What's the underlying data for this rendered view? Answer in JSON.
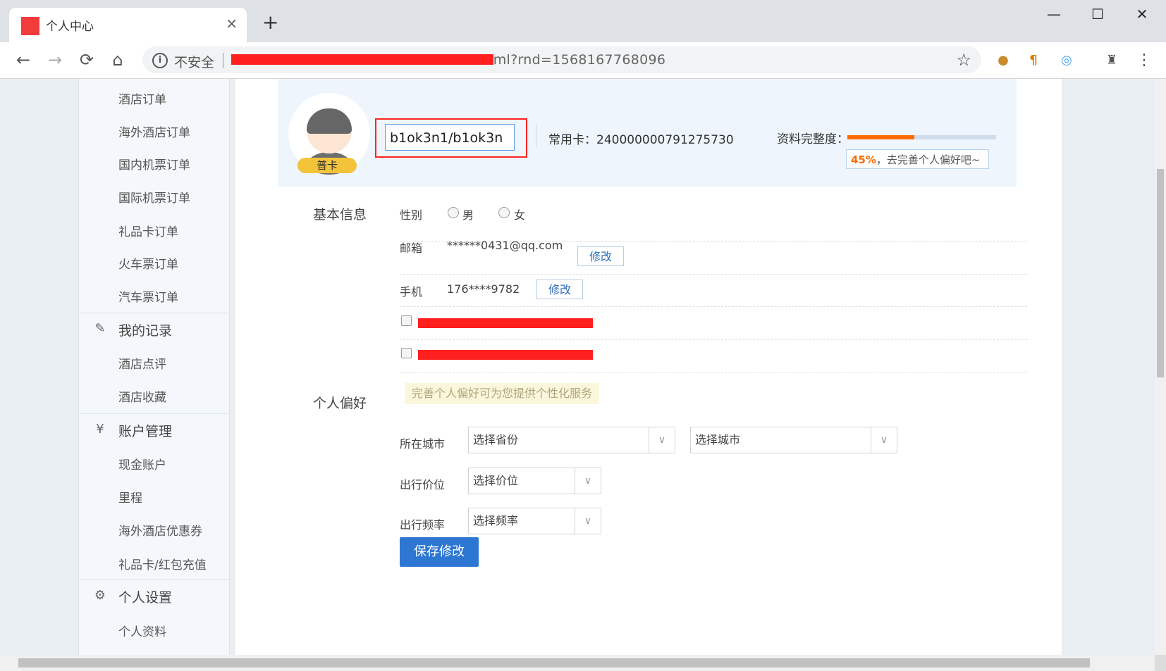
{
  "browser": {
    "tab_title": "个人中心",
    "tab_close": "×",
    "new_tab": "+",
    "window_min": "—",
    "window_max": "☐",
    "window_close": "✕",
    "back": "←",
    "forward": "→",
    "reload": "⟳",
    "home": "⌂",
    "insecure_label": "不安全",
    "url_visible": "tml?rnd=1568167768096",
    "bookmark": "☆",
    "menu": "⋮"
  },
  "sidebar": {
    "items_top": [
      "酒店订单",
      "海外酒店订单",
      "国内机票订单",
      "国际机票订单",
      "礼品卡订单",
      "火车票订单",
      "汽车票订单"
    ],
    "records_title": "我的记录",
    "records_items": [
      "酒店点评",
      "酒店收藏"
    ],
    "account_title": "账户管理",
    "account_items": [
      "现金账户",
      "里程",
      "海外酒店优惠券",
      "礼品卡/红包充值"
    ],
    "settings_title": "个人设置",
    "settings_items": [
      "个人资料"
    ]
  },
  "profile": {
    "badge": "普卡",
    "username": "b1ok3n1/b1ok3n",
    "card_label": "常用卡：240000000791275730",
    "progress_label": "资料完整度：",
    "progress_value": 0.45,
    "progress_percent": "45%",
    "progress_tip": "，去完善个人偏好吧~"
  },
  "basic_info": {
    "title": "基本信息",
    "gender_label": "性别",
    "gender_male": "男",
    "gender_female": "女",
    "email_label": "邮箱",
    "email_value": "******0431@qq.com",
    "email_edit": "修改",
    "phone_label": "手机",
    "phone_value": "176****9782",
    "phone_edit": "修改"
  },
  "preferences": {
    "title": "个人偏好",
    "hint": "完善个人偏好可为您提供个性化服务",
    "city_label": "所在城市",
    "province_select": "选择省份",
    "city_select": "选择城市",
    "price_label": "出行价位",
    "price_select": "选择价位",
    "frequency_label": "出行频率",
    "frequency_select": "选择频率",
    "save_button": "保存修改"
  },
  "colors": {
    "accent_blue": "#2d77d2",
    "progress_orange": "#ff6a00",
    "redaction_red": "#ff1f1f",
    "badge_yellow": "#f3c33a"
  }
}
